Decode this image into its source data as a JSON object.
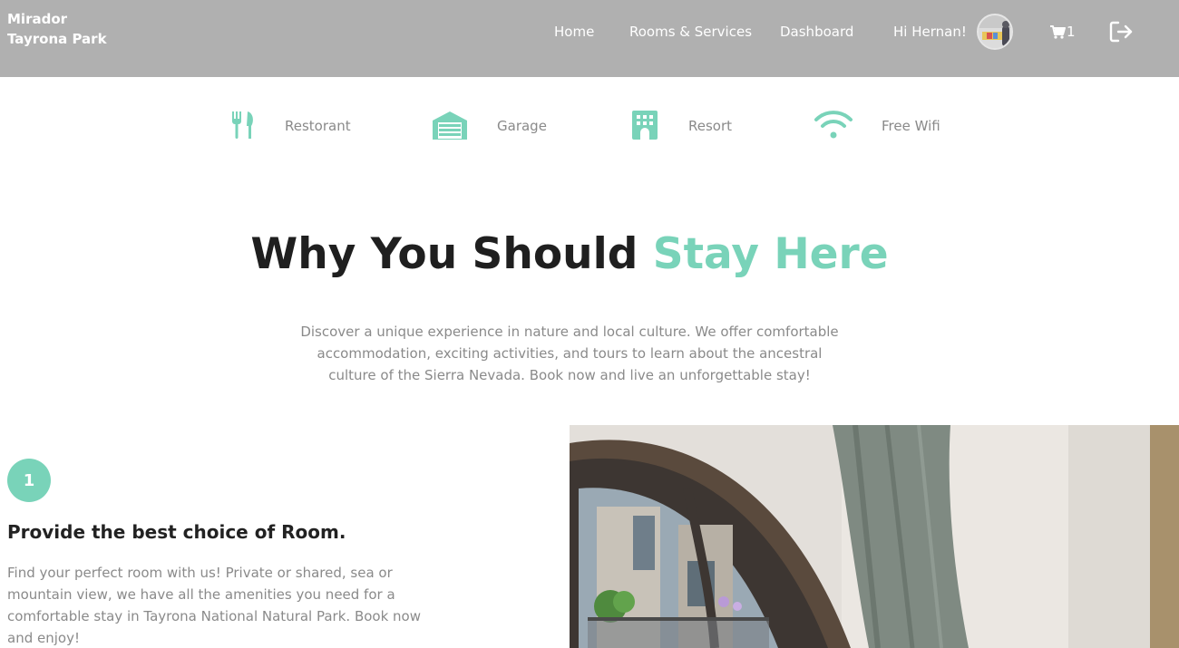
{
  "header": {
    "brand_line1": "Mirador",
    "brand_line2": "Tayrona Park",
    "nav": {
      "home": "Home",
      "rooms": "Rooms & Services",
      "dashboard": "Dashboard"
    },
    "greeting": "Hi Hernan!",
    "cart_count": "1"
  },
  "amenities": [
    {
      "label": "Restorant",
      "icon": "utensils-icon"
    },
    {
      "label": "Garage",
      "icon": "garage-icon"
    },
    {
      "label": "Resort",
      "icon": "building-icon"
    },
    {
      "label": "Free Wifi",
      "icon": "wifi-icon"
    }
  ],
  "why": {
    "title_main": "Why You Should",
    "title_accent": "Stay Here",
    "description": "Discover a unique experience in nature and local culture. We offer comfortable accommodation, exciting activities, and tours to learn about the ancestral culture of the Sierra Nevada. Book now and live an unforgettable stay!"
  },
  "feature": {
    "number": "1",
    "title": "Provide the best choice of Room.",
    "text": "Find your perfect room with us! Private or shared, sea or mountain view, we have all the amenities you need for a comfortable stay in Tayrona National Natural Park. Book now and enjoy!"
  },
  "colors": {
    "accent": "#79d3b9",
    "header_bg": "#b0b0b0",
    "muted_text": "#8a8a8a"
  }
}
